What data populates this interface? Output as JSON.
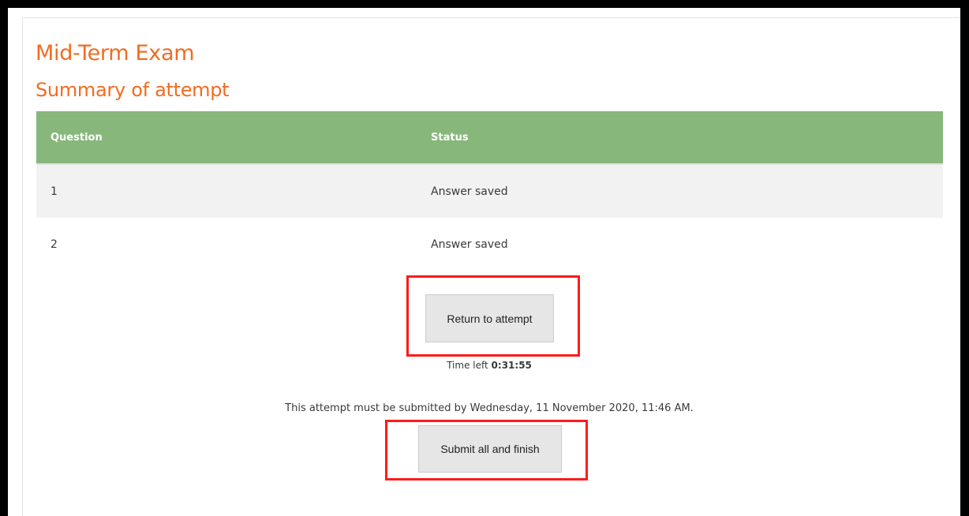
{
  "quiz": {
    "title": "Mid-Term Exam",
    "section_title": "Summary of attempt"
  },
  "table": {
    "headers": {
      "question": "Question",
      "status": "Status"
    },
    "rows": [
      {
        "question": "1",
        "status": "Answer saved"
      },
      {
        "question": "2",
        "status": "Answer saved"
      }
    ]
  },
  "actions": {
    "return_label": "Return to attempt",
    "submit_label": "Submit all and finish"
  },
  "timer": {
    "label": "Time left",
    "value": "0:31:55"
  },
  "deadline": {
    "text": "This attempt must be submitted by Wednesday, 11 November 2020, 11:46 AM."
  },
  "colors": {
    "title_orange": "#f26b21",
    "header_green": "#88b77b",
    "highlight_red": "#ff1a1a"
  }
}
